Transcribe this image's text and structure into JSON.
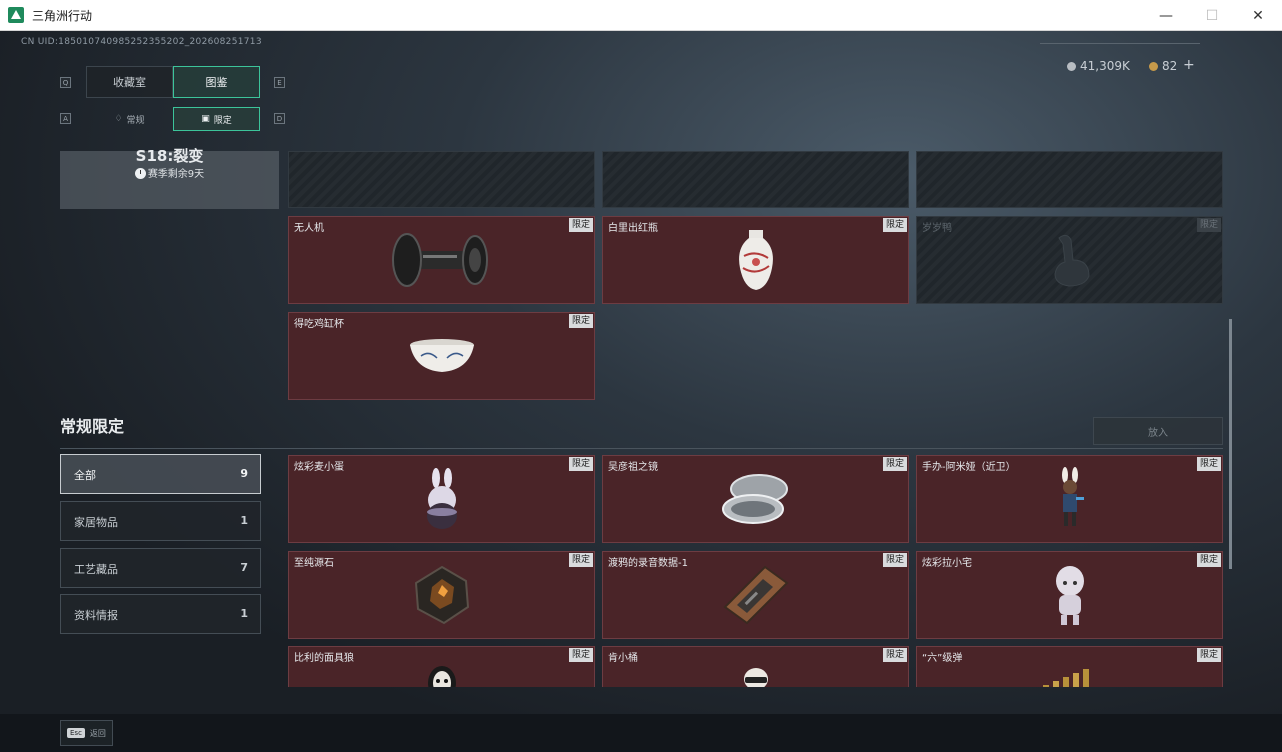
{
  "window": {
    "title": "三角洲行动",
    "minimize": "—",
    "maximize": "☐",
    "close": "✕"
  },
  "header": {
    "uid": "CN UID:185010740985252355202_202608251713",
    "silver_amount": "41,309K",
    "gold_amount": "82",
    "plus": "+"
  },
  "tabs": [
    {
      "label": "收藏室",
      "key": "Q"
    },
    {
      "label": "图鉴",
      "key": "E"
    }
  ],
  "subtabs": [
    {
      "label": "常规",
      "icon": "flame-icon",
      "key": "A"
    },
    {
      "label": "限定",
      "icon": "frame-icon",
      "key": "D"
    }
  ],
  "season": {
    "title": "S18:裂变",
    "remaining": "赛季剩余9天"
  },
  "limited_items": [
    {
      "name": "",
      "badge": "",
      "locked": true
    },
    {
      "name": "",
      "badge": "",
      "locked": true
    },
    {
      "name": "",
      "badge": "",
      "locked": true
    },
    {
      "name": "无人机",
      "badge": "限定",
      "locked": false,
      "icon": "drone-icon"
    },
    {
      "name": "白里出红瓶",
      "badge": "限定",
      "locked": false,
      "icon": "vase-icon"
    },
    {
      "name": "岁岁鸭",
      "badge": "限定",
      "locked": true,
      "icon": "duck-icon"
    },
    {
      "name": "得吃鸡缸杯",
      "badge": "限定",
      "locked": false,
      "icon": "cup-icon"
    }
  ],
  "section": {
    "title": "常规限定",
    "put_button": "放入"
  },
  "filters": [
    {
      "label": "全部",
      "count": "9"
    },
    {
      "label": "家居物品",
      "count": "1"
    },
    {
      "label": "工艺藏品",
      "count": "7"
    },
    {
      "label": "资料情报",
      "count": "1"
    }
  ],
  "regular_items": [
    {
      "name": "炫彩麦小蛋",
      "badge": "限定",
      "icon": "bunny-egg-icon"
    },
    {
      "name": "吴彦祖之镜",
      "badge": "限定",
      "icon": "mirror-icon"
    },
    {
      "name": "手办-阿米娅（近卫）",
      "badge": "限定",
      "icon": "figure-icon"
    },
    {
      "name": "至纯源石",
      "badge": "限定",
      "icon": "crystal-icon"
    },
    {
      "name": "渡鸦的录音数据-1",
      "badge": "限定",
      "icon": "recorder-icon"
    },
    {
      "name": "炫彩拉小宅",
      "badge": "限定",
      "icon": "doll-icon"
    },
    {
      "name": "比利的面具狼",
      "badge": "限定",
      "icon": "mask-icon"
    },
    {
      "name": "肯小桶",
      "badge": "限定",
      "icon": "bucket-icon"
    },
    {
      "name": "“六”级弹",
      "badge": "限定",
      "icon": "ammo-icon"
    }
  ],
  "footer": {
    "esc_key": "Esc",
    "back_label": "返回"
  },
  "colors": {
    "accent": "#3cc49a",
    "card_bg": "#4a2428",
    "badge_bg": "#d9dbdd"
  }
}
